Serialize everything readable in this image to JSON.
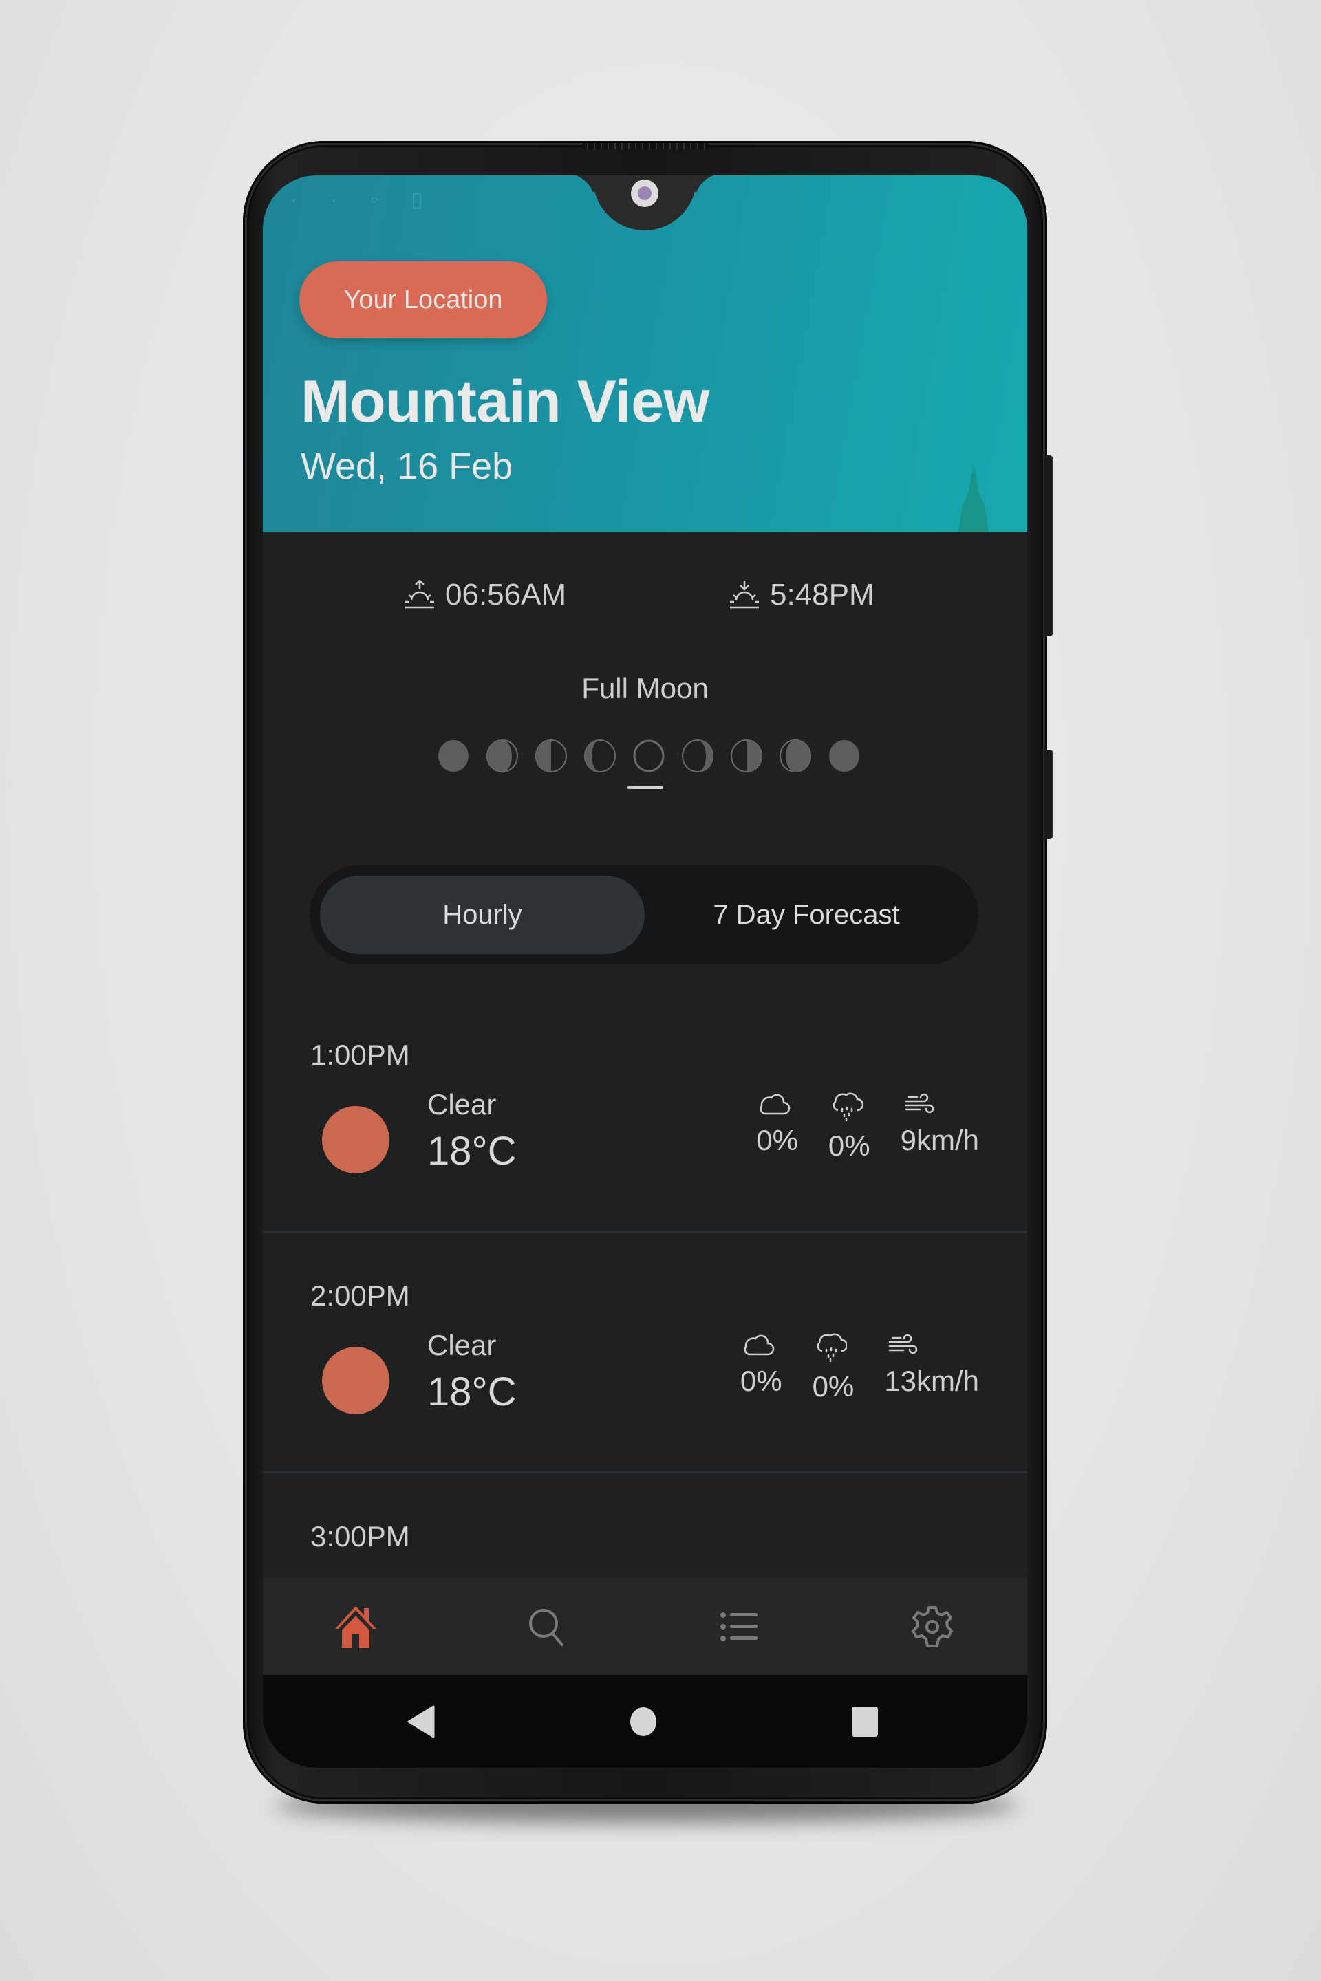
{
  "app": {
    "header": {
      "location_button": "Your Location",
      "city": "Mountain View",
      "date": "Wed, 16 Feb"
    },
    "sun": {
      "sunrise_icon": "sunrise-icon",
      "sunrise": "06:56AM",
      "sunset_icon": "sunset-icon",
      "sunset": "5:48PM"
    },
    "moon": {
      "phase_label": "Full Moon",
      "phases": [
        "new-moon",
        "waxing-crescent",
        "first-quarter",
        "waxing-gibbous",
        "full-moon",
        "waning-gibbous",
        "last-quarter",
        "waning-crescent",
        "new-moon"
      ],
      "selected_index": 4
    },
    "tabs": [
      {
        "label": "Hourly",
        "active": true
      },
      {
        "label": "7 Day Forecast",
        "active": false
      }
    ],
    "hourly": [
      {
        "time": "1:00PM",
        "condition": "Clear",
        "temp": "18°C",
        "cloud": "0%",
        "precip": "0%",
        "wind": "9km/h",
        "icon": "sun-icon"
      },
      {
        "time": "2:00PM",
        "condition": "Clear",
        "temp": "18°C",
        "cloud": "0%",
        "precip": "0%",
        "wind": "13km/h",
        "icon": "sun-icon"
      },
      {
        "time": "3:00PM"
      }
    ],
    "bottom_nav": [
      {
        "name": "home",
        "icon": "home-icon",
        "active": true
      },
      {
        "name": "search",
        "icon": "search-icon",
        "active": false
      },
      {
        "name": "list",
        "icon": "list-icon",
        "active": false
      },
      {
        "name": "settings",
        "icon": "gear-icon",
        "active": false
      }
    ],
    "system_nav": [
      "back-icon",
      "home-circle-icon",
      "recents-icon"
    ],
    "colors": {
      "accent": "#d96a55",
      "sun": "#cb6a50",
      "header_teal": "#1a95a5",
      "background": "#1e2021",
      "nav_inactive": "#7a7a7a"
    }
  }
}
